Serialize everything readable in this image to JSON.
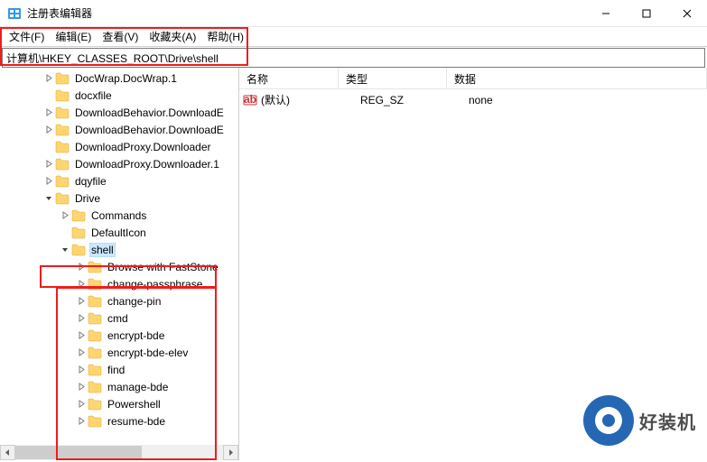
{
  "window": {
    "title": "注册表编辑器"
  },
  "menu": {
    "file": "文件(F)",
    "edit": "编辑(E)",
    "view": "查看(V)",
    "favorites": "收藏夹(A)",
    "help": "帮助(H)"
  },
  "address": "计算机\\HKEY_CLASSES_ROOT\\Drive\\shell",
  "tree": {
    "items": [
      {
        "label": "DocWrap.DocWrap.1",
        "indent": 2,
        "expander": "closed"
      },
      {
        "label": "docxfile",
        "indent": 2,
        "expander": "none"
      },
      {
        "label": "DownloadBehavior.DownloadE",
        "indent": 2,
        "expander": "closed"
      },
      {
        "label": "DownloadBehavior.DownloadE",
        "indent": 2,
        "expander": "closed"
      },
      {
        "label": "DownloadProxy.Downloader",
        "indent": 2,
        "expander": "none"
      },
      {
        "label": "DownloadProxy.Downloader.1",
        "indent": 2,
        "expander": "closed"
      },
      {
        "label": "dqyfile",
        "indent": 2,
        "expander": "closed"
      },
      {
        "label": "Drive",
        "indent": 2,
        "expander": "open"
      },
      {
        "label": "Commands",
        "indent": 3,
        "expander": "closed"
      },
      {
        "label": "DefaultIcon",
        "indent": 3,
        "expander": "none"
      },
      {
        "label": "shell",
        "indent": 3,
        "expander": "open",
        "selected": true
      },
      {
        "label": "Browse with FastStone",
        "indent": 4,
        "expander": "closed"
      },
      {
        "label": "change-passphrase",
        "indent": 4,
        "expander": "closed"
      },
      {
        "label": "change-pin",
        "indent": 4,
        "expander": "closed"
      },
      {
        "label": "cmd",
        "indent": 4,
        "expander": "closed"
      },
      {
        "label": "encrypt-bde",
        "indent": 4,
        "expander": "closed"
      },
      {
        "label": "encrypt-bde-elev",
        "indent": 4,
        "expander": "closed"
      },
      {
        "label": "find",
        "indent": 4,
        "expander": "closed"
      },
      {
        "label": "manage-bde",
        "indent": 4,
        "expander": "closed"
      },
      {
        "label": "Powershell",
        "indent": 4,
        "expander": "closed"
      },
      {
        "label": "resume-bde",
        "indent": 4,
        "expander": "closed"
      }
    ]
  },
  "list": {
    "headers": {
      "name": "名称",
      "type": "类型",
      "data": "数据"
    },
    "rows": [
      {
        "name": "(默认)",
        "type": "REG_SZ",
        "data": "none"
      }
    ]
  },
  "watermark": "好装机"
}
